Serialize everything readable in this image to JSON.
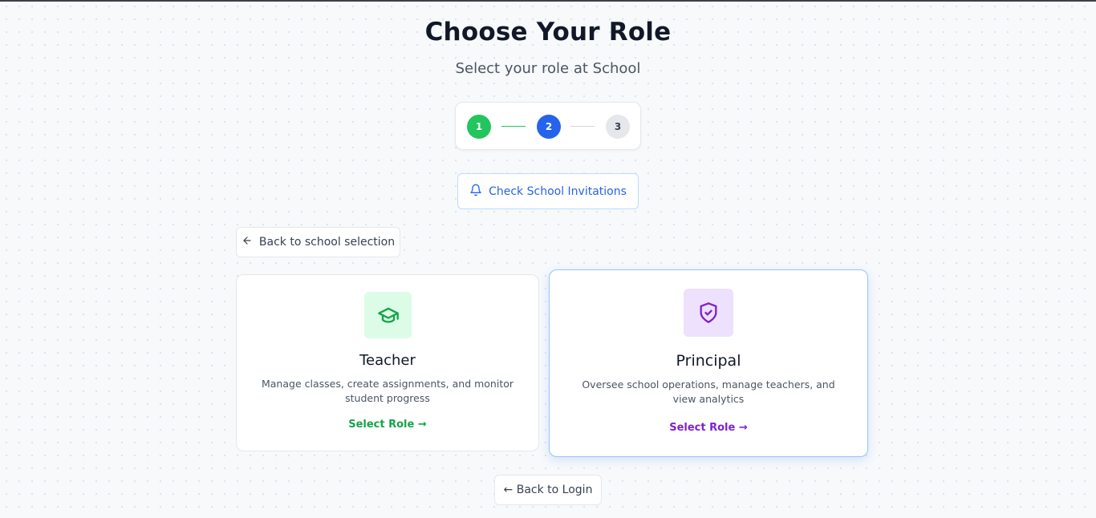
{
  "header": {
    "title": "Choose Your Role",
    "subtitle": "Select your role at School"
  },
  "stepper": {
    "steps": [
      "1",
      "2",
      "3"
    ],
    "current_step": 2
  },
  "invitations_button": {
    "label": "Check School Invitations",
    "icon": "bell-icon"
  },
  "back_school_button": {
    "label": "Back to school selection",
    "icon": "arrow-left-icon"
  },
  "roles": [
    {
      "title": "Teacher",
      "description": "Manage classes, create assignments, and monitor student progress",
      "cta": "Select Role →",
      "icon": "graduation-cap-icon",
      "accent": "#16a34a",
      "icon_bg": "#dcfce7"
    },
    {
      "title": "Principal",
      "description": "Oversee school operations, manage teachers, and view analytics",
      "cta": "Select Role →",
      "icon": "shield-check-icon",
      "accent": "#7e22ce",
      "icon_bg": "#ede1fd"
    }
  ],
  "back_login_button": {
    "label": "← Back to Login"
  },
  "colors": {
    "step_done": "#22c55e",
    "step_current": "#2563eb",
    "step_pending": "#e5e7eb",
    "link_blue": "#2563eb"
  }
}
